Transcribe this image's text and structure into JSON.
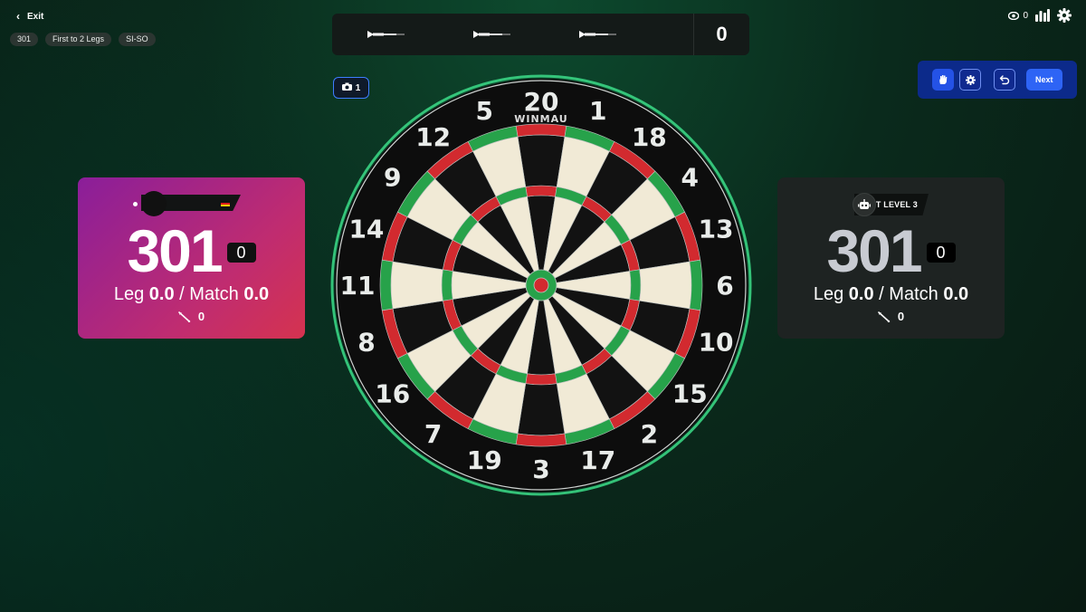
{
  "header": {
    "exit_label": "Exit",
    "tags": [
      "301",
      "First to 2 Legs",
      "SI-SO"
    ],
    "viewers_count": "0"
  },
  "dart_tray": {
    "total": "0"
  },
  "camera": {
    "count": "1"
  },
  "controls": {
    "next_label": "Next"
  },
  "player1": {
    "score": "301",
    "turn_score": "0",
    "leg_label": "Leg",
    "leg_avg": "0.0",
    "separator": "/",
    "match_label": "Match",
    "match_avg": "0.0",
    "darts_thrown": "0"
  },
  "player2": {
    "name": "BOT LEVEL 3",
    "score": "301",
    "turn_score": "0",
    "leg_label": "Leg",
    "leg_avg": "0.0",
    "separator": "/",
    "match_label": "Match",
    "match_avg": "0.0",
    "darts_thrown": "0"
  },
  "dartboard": {
    "numbers": [
      "20",
      "1",
      "18",
      "4",
      "13",
      "6",
      "10",
      "15",
      "2",
      "17",
      "3",
      "19",
      "7",
      "16",
      "8",
      "11",
      "14",
      "9",
      "12",
      "5"
    ],
    "brand": "WINMAU"
  },
  "colors": {
    "accent_blue": "#2e64f5",
    "p1_card_start": "#8a1e9a",
    "p1_card_end": "#d5334f",
    "board_red": "#d22a2f",
    "board_green": "#27a24a",
    "board_cream": "#f1ead6"
  }
}
